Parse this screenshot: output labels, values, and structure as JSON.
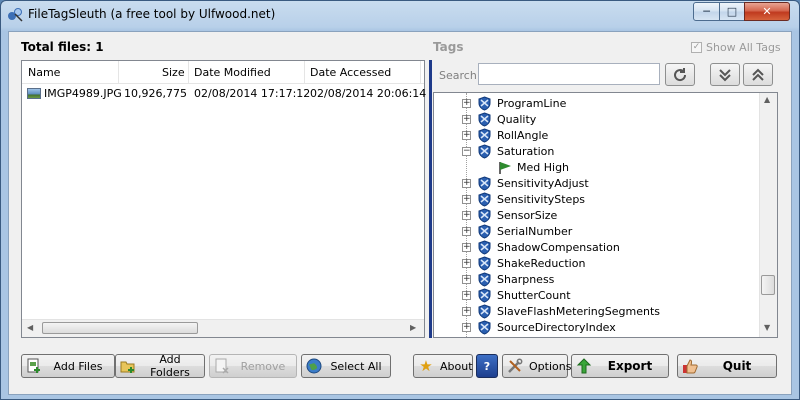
{
  "window": {
    "title": "FileTagSleuth (a free tool by Ulfwood.net)",
    "min_glyph": "─",
    "max_glyph": "□",
    "close_glyph": "✕"
  },
  "files": {
    "total_label": "Total files: 1",
    "columns": [
      "Name",
      "Size",
      "Date Modified",
      "Date Accessed"
    ],
    "rows": [
      {
        "name": "IMGP4989.JPG",
        "size": "10,926,775",
        "modified": "02/08/2014 17:17:12",
        "accessed": "02/08/2014 20:06:14"
      }
    ]
  },
  "tags": {
    "title": "Tags",
    "show_all_label": "Show All Tags",
    "show_all_checked": true,
    "search_label": "Search",
    "search_value": "",
    "tree": [
      {
        "label": "ProgramLine",
        "expander": "+"
      },
      {
        "label": "Quality",
        "expander": "+"
      },
      {
        "label": "RollAngle",
        "expander": "+"
      },
      {
        "label": "Saturation",
        "expander": "−"
      },
      {
        "label": "Med High",
        "child": true
      },
      {
        "label": "SensitivityAdjust",
        "expander": "+"
      },
      {
        "label": "SensitivitySteps",
        "expander": "+"
      },
      {
        "label": "SensorSize",
        "expander": "+"
      },
      {
        "label": "SerialNumber",
        "expander": "+"
      },
      {
        "label": "ShadowCompensation",
        "expander": "+"
      },
      {
        "label": "ShakeReduction",
        "expander": "+"
      },
      {
        "label": "Sharpness",
        "expander": "+"
      },
      {
        "label": "ShutterCount",
        "expander": "+"
      },
      {
        "label": "SlaveFlashMeteringSegments",
        "expander": "+"
      },
      {
        "label": "SourceDirectoryIndex",
        "expander": "+"
      }
    ]
  },
  "buttons": {
    "add_files": "Add Files",
    "add_folders": "Add Folders",
    "remove": "Remove",
    "select_all": "Select All",
    "about": "About",
    "help": "?",
    "options": "Options",
    "export": "Export",
    "quit": "Quit"
  },
  "colors": {
    "splitter": "#1e3a8a",
    "shield": "#2a5fb0",
    "flag": "#2e8b2e"
  }
}
